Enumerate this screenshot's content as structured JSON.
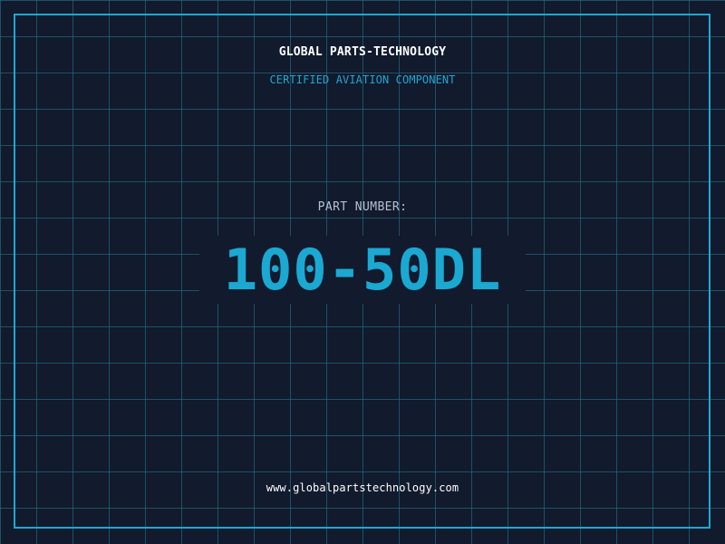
{
  "brand": "GLOBAL PARTS-TECHNOLOGY",
  "subtitle": "CERTIFIED AVIATION COMPONENT",
  "part_label": "PART NUMBER:",
  "part_number": "100-50DL",
  "website": "www.globalpartstechnology.com",
  "colors": {
    "background": "#121a2d",
    "grid": "#24687c",
    "accent": "#1ba9d2",
    "text": "#ffffff",
    "label": "#b7c1d1"
  }
}
